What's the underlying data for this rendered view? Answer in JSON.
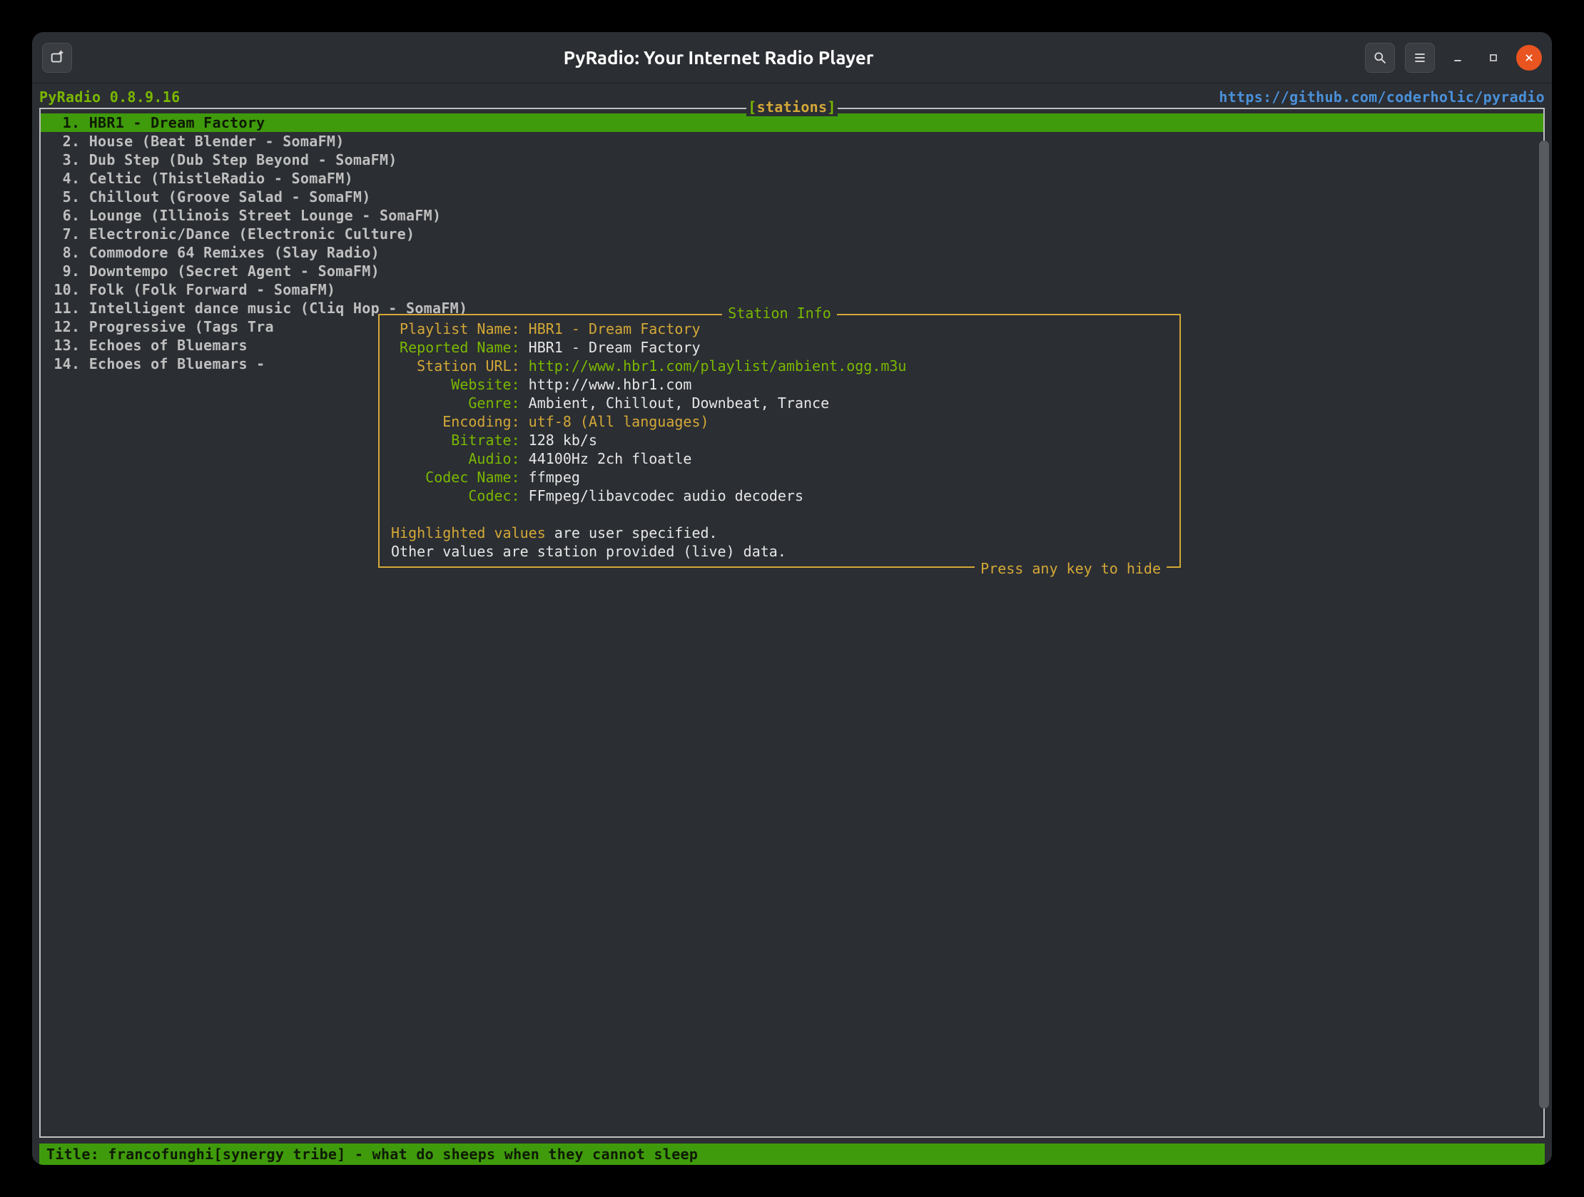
{
  "window": {
    "title": "PyRadio: Your Internet Radio Player"
  },
  "header": {
    "app_version": "PyRadio 0.8.9.16",
    "project_url": "https://github.com/coderholic/pyradio"
  },
  "list_box": {
    "title": "stations",
    "selected_index": 0,
    "items": [
      {
        "num": " 1",
        "label": "HBR1 - Dream Factory"
      },
      {
        "num": " 2",
        "label": "House (Beat Blender - SomaFM)"
      },
      {
        "num": " 3",
        "label": "Dub Step (Dub Step Beyond - SomaFM)"
      },
      {
        "num": " 4",
        "label": "Celtic (ThistleRadio - SomaFM)"
      },
      {
        "num": " 5",
        "label": "Chillout (Groove Salad - SomaFM)"
      },
      {
        "num": " 6",
        "label": "Lounge (Illinois Street Lounge - SomaFM)"
      },
      {
        "num": " 7",
        "label": "Electronic/Dance (Electronic Culture)"
      },
      {
        "num": " 8",
        "label": "Commodore 64 Remixes (Slay Radio)"
      },
      {
        "num": " 9",
        "label": "Downtempo (Secret Agent - SomaFM)"
      },
      {
        "num": "10",
        "label": "Folk (Folk Forward - SomaFM)"
      },
      {
        "num": "11",
        "label": "Intelligent dance music (Cliq Hop - SomaFM)"
      },
      {
        "num": "12",
        "label": "Progressive (Tags Tra"
      },
      {
        "num": "13",
        "label": "Echoes of Bluemars"
      },
      {
        "num": "14",
        "label": "Echoes of Bluemars - "
      }
    ]
  },
  "info": {
    "title": "Station Info",
    "fields": {
      "playlist_name": {
        "label": " Playlist Name:",
        "value": "HBR1 - Dream Factory"
      },
      "reported_name": {
        "label": " Reported Name:",
        "value": "HBR1 - Dream Factory"
      },
      "station_url": {
        "label": "   Station URL:",
        "value": "http://www.hbr1.com/playlist/ambient.ogg.m3u"
      },
      "website": {
        "label": "       Website:",
        "value": "http://www.hbr1.com"
      },
      "genre": {
        "label": "         Genre:",
        "value": "Ambient, Chillout, Downbeat, Trance"
      },
      "encoding": {
        "label": "      Encoding:",
        "value": "utf-8 (All languages)"
      },
      "bitrate": {
        "label": "       Bitrate:",
        "value": "128 kb/s"
      },
      "audio": {
        "label": "         Audio:",
        "value": "44100Hz 2ch floatle"
      },
      "codec_name": {
        "label": "    Codec Name:",
        "value": "ffmpeg"
      },
      "codec": {
        "label": "         Codec:",
        "value": "FFmpeg/libavcodec audio decoders"
      }
    },
    "note_hl": "Highlighted values",
    "note_rest": " are user specified.",
    "note_line2": "Other values are station provided (live) data.",
    "footer": "Press any key to hide"
  },
  "status": {
    "text": "Title: francofunghi[synergy tribe] - what do sheeps when they cannot sleep"
  }
}
